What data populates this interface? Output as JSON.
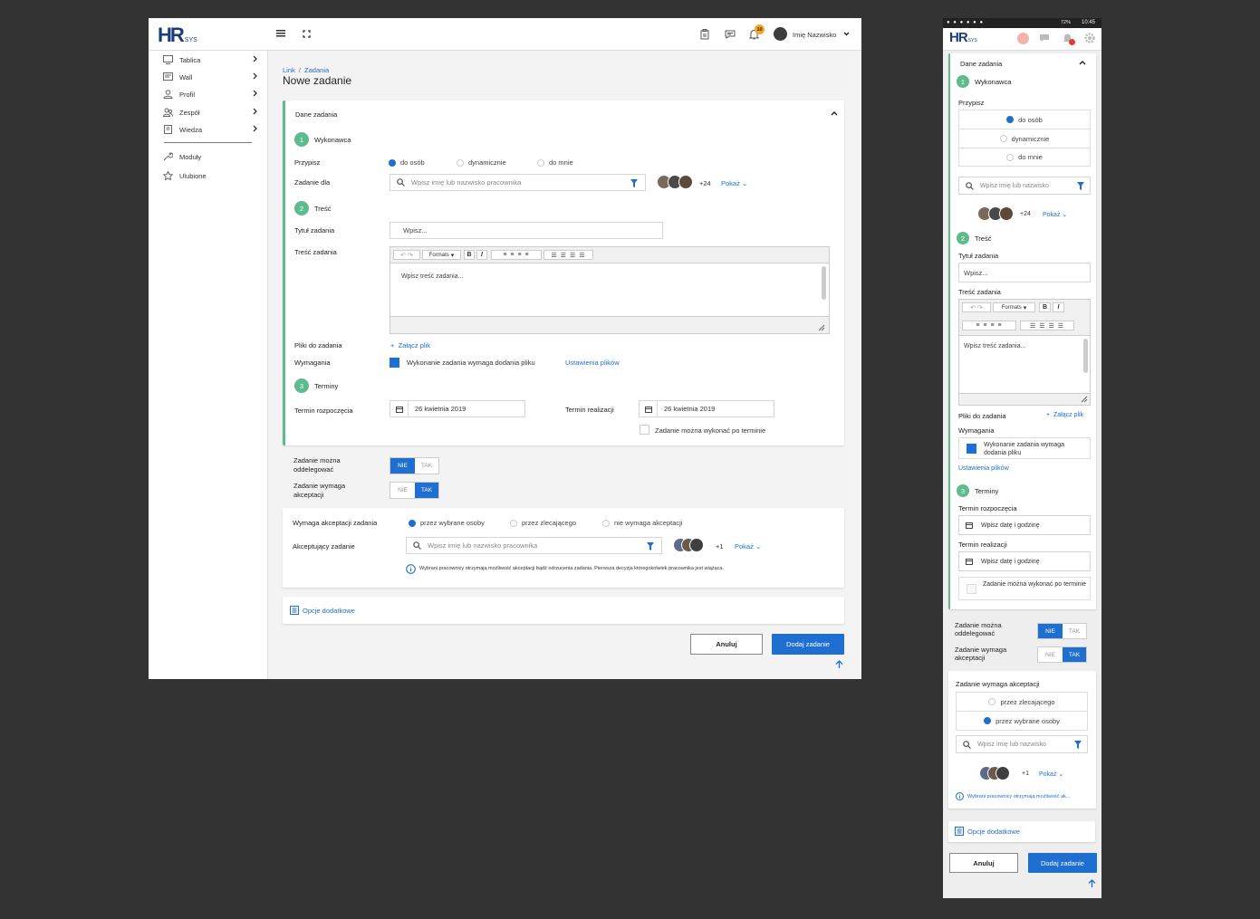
{
  "app": {
    "logo_main": "HR",
    "logo_sub": "SYS",
    "user_name": "Imię Nazwisko",
    "notif_count": "10"
  },
  "sidebar": {
    "items": [
      {
        "label": "Tablica"
      },
      {
        "label": "Wall"
      },
      {
        "label": "Profil"
      },
      {
        "label": "Zespół"
      },
      {
        "label": "Wiedza"
      },
      {
        "label": "Moduły"
      },
      {
        "label": "Ulubione"
      }
    ]
  },
  "breadcrumb": {
    "link": "Link",
    "sep": "/",
    "current": "Zadania"
  },
  "page_title": "Nowe zadanie",
  "section": {
    "title": "Dane zadania"
  },
  "steps": {
    "s1": {
      "num": "1",
      "label": "Wykonawca"
    },
    "s2": {
      "num": "2",
      "label": "Treść"
    },
    "s3": {
      "num": "3",
      "label": "Terminy"
    }
  },
  "assign": {
    "label": "Przypisz",
    "options": [
      "do osób",
      "dynamicznie",
      "do mnie"
    ],
    "selected": "do osób",
    "for_label": "Zadanie dla",
    "search_placeholder": "Wpisz imię lub nazwisko pracownika",
    "search_placeholder_short": "Wpisz imię lub nazwisko",
    "more_count": "+24",
    "show": "Pokaż"
  },
  "content": {
    "title_label": "Tytuł zadania",
    "title_placeholder": "Wpisz...",
    "body_label": "Treść zadania",
    "body_placeholder": "Wpisz treść zadania...",
    "formats": "Formats",
    "bold": "B",
    "italic": "I",
    "files_label": "Pliki do zadania",
    "attach": "Załącz plik",
    "req_label": "Wymagania",
    "req_text": "Wykonanie zadania wymaga dodania pliku",
    "req_settings": "Ustawienia plików"
  },
  "dates": {
    "start_label": "Termin rozpoczęcia",
    "start_value": "26 kwietnia 2019",
    "end_label": "Termin realizacji",
    "end_value": "26 kwietnia 2019",
    "date_placeholder": "Wpisz datę i godzinę",
    "late_label": "Zadanie można wykonać po terminie"
  },
  "delegate": {
    "label": "Zadanie można oddelegować",
    "no": "NIE",
    "yes": "TAK",
    "value": "NIE"
  },
  "acceptance": {
    "label": "Zadanie wymaga akceptacji",
    "no": "NIE",
    "yes": "TAK",
    "value": "TAK",
    "req_label": "Wymaga akceptacji zadania",
    "req_label_mobile": "Zadanie wymaga akceptacji",
    "options": [
      "przez wybrane osoby",
      "przez zlecającego",
      "nie wymaga akceptacji"
    ],
    "selected": "przez wybrane osoby",
    "acceptor_label": "Akceptujący zadanie",
    "more_count": "+1",
    "info": "Wybrani pracownicy otrzymają możliwość akceptacji bądź odrzucenia zadania. Pierwsza decyzja któregokolwiek pracownika jest wiążąca.",
    "info_short": "Wybrani pracownicy otrzymają możliwość ak..."
  },
  "extra": {
    "label": "Opcje dodatkowe"
  },
  "actions": {
    "cancel": "Anuluj",
    "submit": "Dodaj zadanie"
  },
  "statusbar": {
    "battery": "72%",
    "time": "10:45"
  },
  "colors": {
    "accent": "#1e6fd0",
    "step": "#5dbb8e",
    "notif": "#f5a623"
  }
}
